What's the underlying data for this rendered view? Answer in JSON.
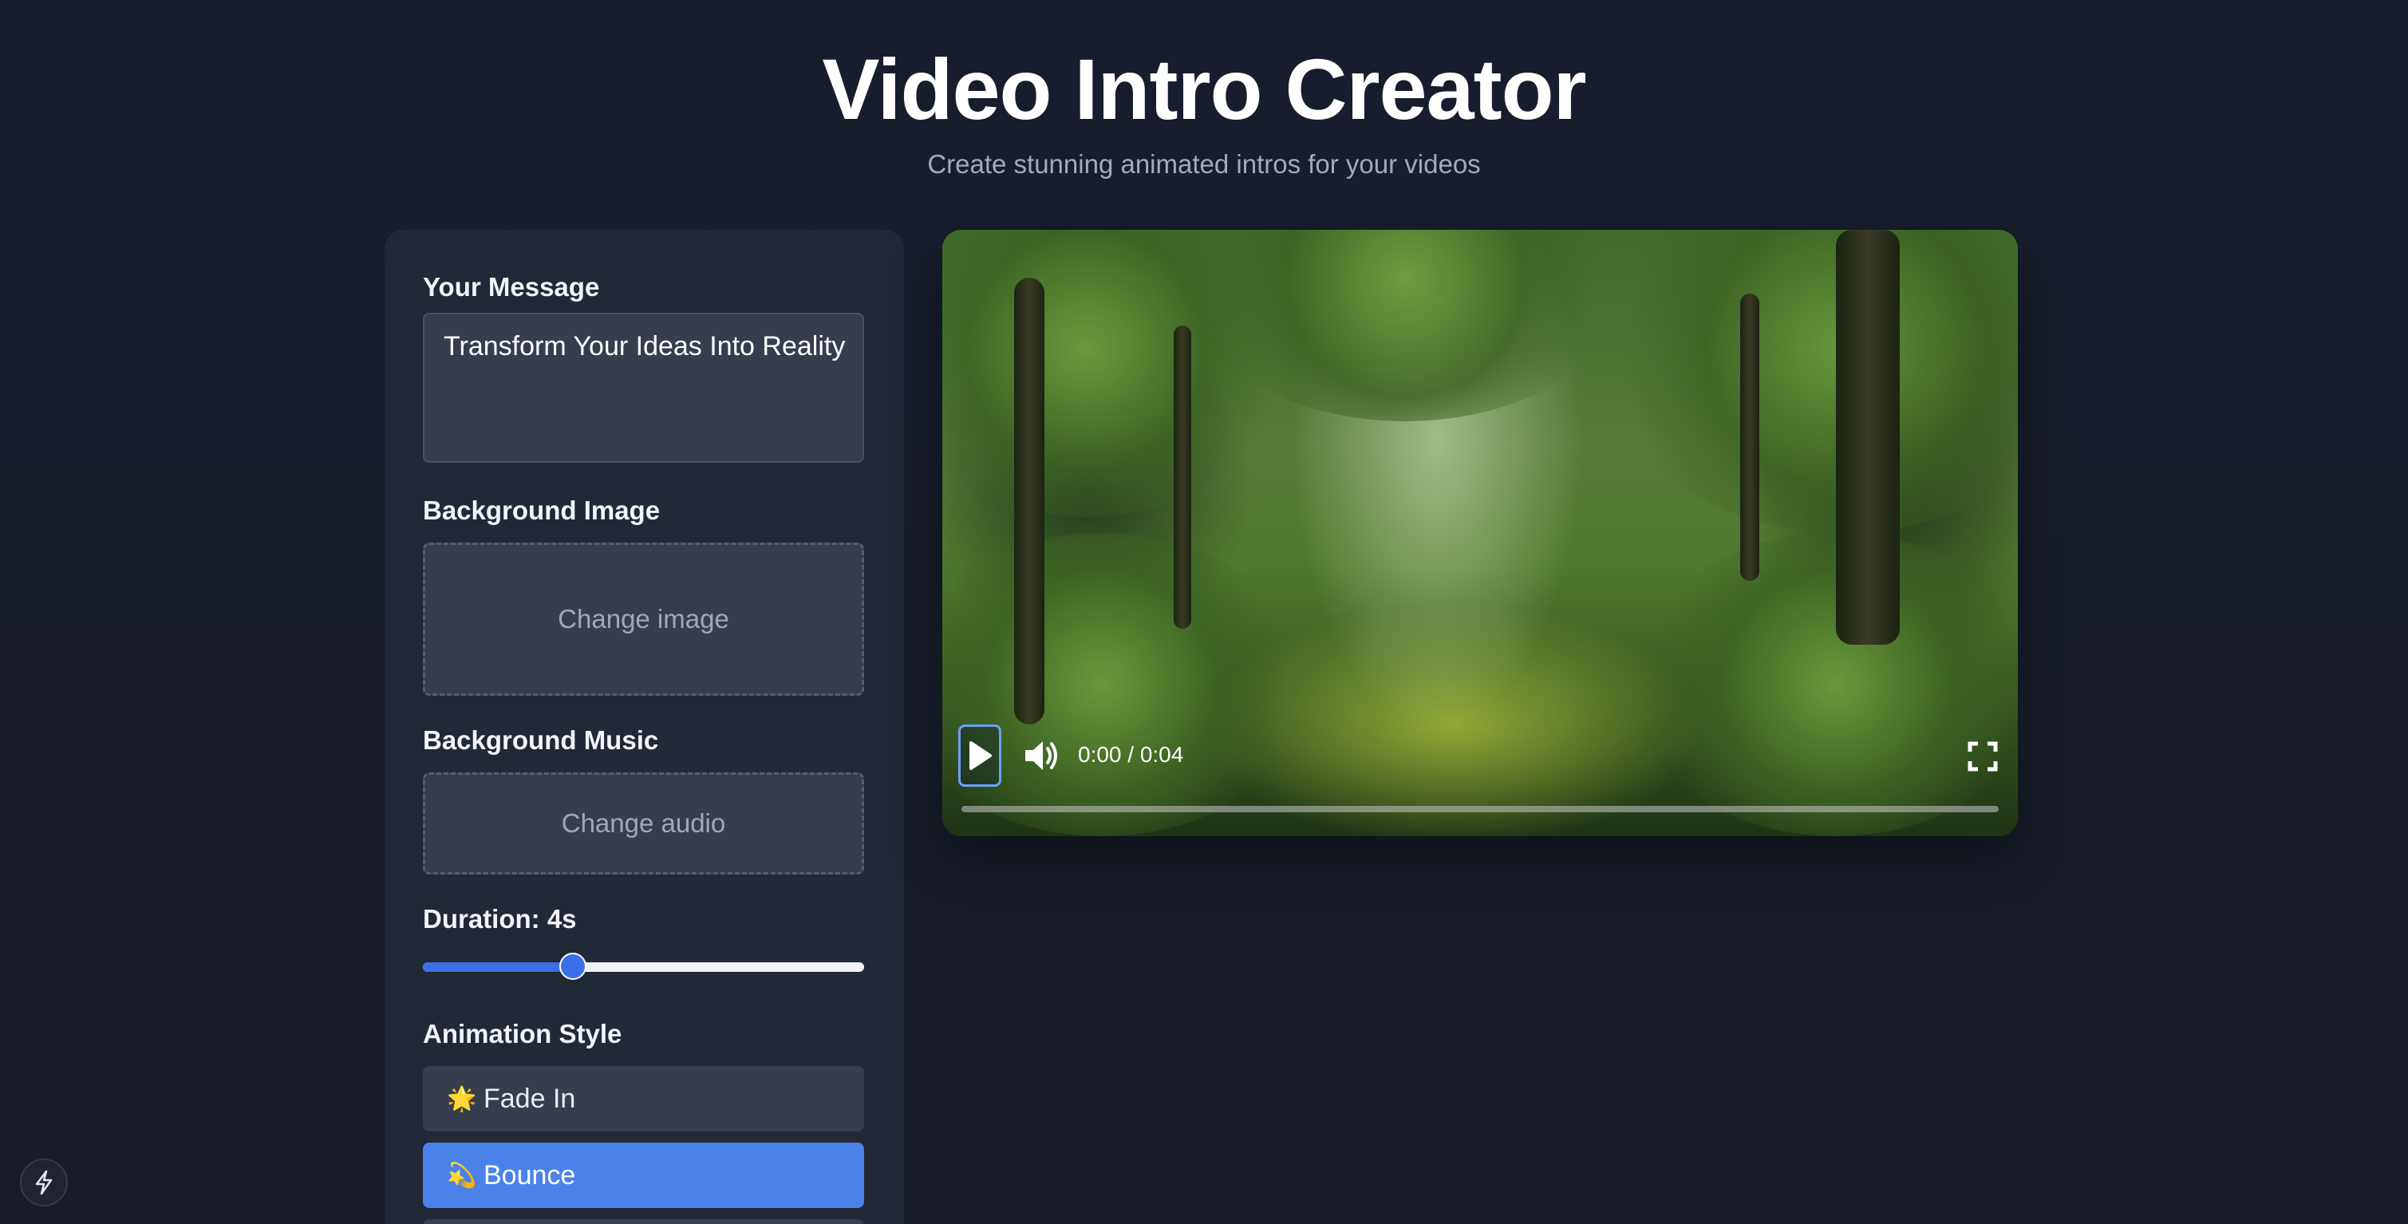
{
  "header": {
    "title": "Video Intro Creator",
    "subtitle": "Create stunning animated intros for your videos"
  },
  "form": {
    "message_label": "Your Message",
    "message_value": "Transform Your Ideas Into Reality",
    "background_image_label": "Background Image",
    "background_image_button": "Change image",
    "background_music_label": "Background Music",
    "background_music_button": "Change audio",
    "duration_label": "Duration: 4s",
    "duration_slider_fraction": 0.34,
    "animation_label": "Animation Style",
    "animations": [
      {
        "emoji": "🌟",
        "label": "Fade In",
        "selected": false
      },
      {
        "emoji": "💫",
        "label": "Bounce",
        "selected": true
      }
    ]
  },
  "player": {
    "time": "0:00 / 0:04",
    "progress_fraction": 0.0,
    "icons": {
      "play": "play-icon",
      "volume": "volume-icon",
      "fullscreen": "fullscreen-icon"
    }
  },
  "colors": {
    "background": "#171c29",
    "panel": "#212836",
    "accent": "#4b82ea"
  },
  "badge": {
    "icon": "bolt-icon"
  }
}
